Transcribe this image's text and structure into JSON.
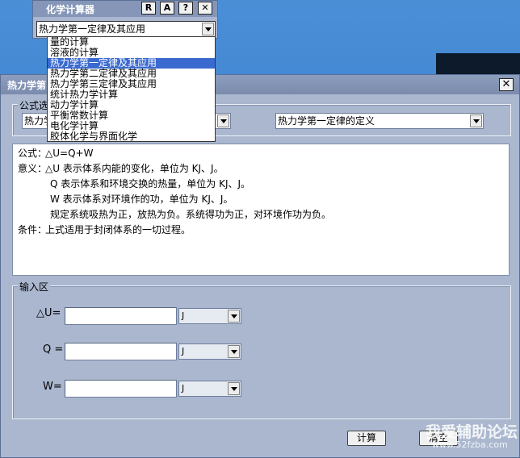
{
  "calculator": {
    "title": "化学计算器",
    "buttons": [
      "R",
      "A",
      "?",
      "✕"
    ],
    "selected_category": "热力学第一定律及其应用",
    "dropdown_items": [
      "量的计算",
      "溶液的计算",
      "热力学第一定律及其应用",
      "热力学第二定律及其应用",
      "热力学第三定律及其应用",
      "统计热力学计算",
      "动力学计算",
      "平衡常数计算",
      "电化学计算",
      "胶体化学与界面化学"
    ],
    "selected_index": 2
  },
  "main": {
    "title": "热力学第",
    "close_label": "✕",
    "formula_group_label": "公式选",
    "category_value": "热力学",
    "definition_value": "热力学第一定律的定义",
    "formula_lines": [
      {
        "label": "公式：",
        "text": "△U=Q+W"
      },
      {
        "label": "意义：",
        "text": "△U 表示体系内能的变化，单位为 KJ、J。"
      },
      {
        "label": "",
        "text": "Q 表示体系和环境交换的热量，单位为 KJ、J。"
      },
      {
        "label": "",
        "text": "W 表示体系对环境作的功，单位为 KJ、J。"
      },
      {
        "label": "",
        "text": "规定系统吸热为正，放热为负。系统得功为正，对环境作功为负。"
      },
      {
        "label": "条件：",
        "text": "上式适用于封闭体系的一切过程。"
      }
    ],
    "input_group_label": "输入区",
    "inputs": [
      {
        "label": "△U=",
        "value": "",
        "unit": "J"
      },
      {
        "label": "Q =",
        "value": "",
        "unit": "J"
      },
      {
        "label": "W=",
        "value": "",
        "unit": "J"
      }
    ],
    "calc_label": "计算",
    "clear_label": "清空"
  },
  "watermark": {
    "line1": "我爱辅助论坛",
    "line2": "www.52fzba.com"
  }
}
